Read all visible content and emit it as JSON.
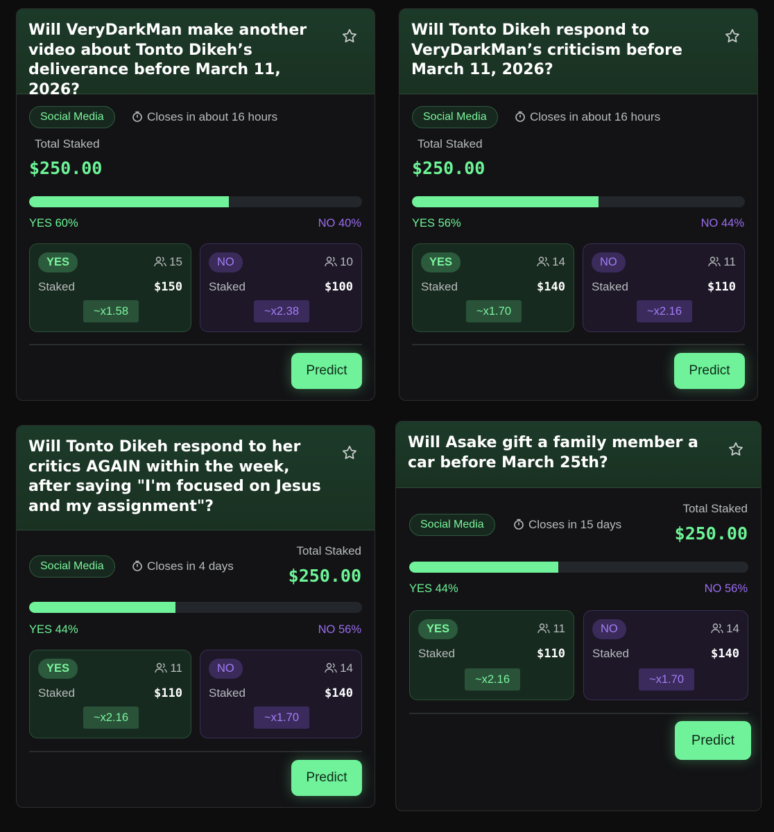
{
  "colors": {
    "accent_yes": "#6ff29a",
    "accent_no": "#9a6cf0",
    "background": "#0d0d0e"
  },
  "icons": {
    "favorite": "star-icon",
    "closes": "stopwatch-icon",
    "participants": "users-icon"
  },
  "cards": [
    {
      "title": "Will VeryDarkMan make another video about Tonto Dikeh’s deliverance before March 11, 2026?",
      "category": "Social Media",
      "closes": "Closes in about 16 hours",
      "total_staked_label": "Total Staked",
      "total_staked": "$250.00",
      "yes_share": 0.6,
      "yes_pct_label": "YES 60%",
      "no_pct_label": "NO 40%",
      "yes": {
        "label": "YES",
        "count": "15",
        "staked_label": "Staked",
        "staked": "$150",
        "multiplier": "~x1.58"
      },
      "no": {
        "label": "NO",
        "count": "10",
        "staked_label": "Staked",
        "staked": "$100",
        "multiplier": "~x2.38"
      },
      "predict_label": "Predict"
    },
    {
      "title": "Will Tonto Dikeh respond to VeryDarkMan’s criticism before March 11, 2026?",
      "category": "Social Media",
      "closes": "Closes in about 16 hours",
      "total_staked_label": "Total Staked",
      "total_staked": "$250.00",
      "yes_share": 0.56,
      "yes_pct_label": "YES 56%",
      "no_pct_label": "NO 44%",
      "yes": {
        "label": "YES",
        "count": "14",
        "staked_label": "Staked",
        "staked": "$140",
        "multiplier": "~x1.70"
      },
      "no": {
        "label": "NO",
        "count": "11",
        "staked_label": "Staked",
        "staked": "$110",
        "multiplier": "~x2.16"
      },
      "predict_label": "Predict"
    },
    {
      "title": "Will Tonto Dikeh respond to her critics AGAIN within the week, after saying \"I'm focused on Jesus and my assignment\"?",
      "category": "Social Media",
      "closes": "Closes in 4 days",
      "total_staked_label": "Total Staked",
      "total_staked": "$250.00",
      "yes_share": 0.44,
      "yes_pct_label": "YES 44%",
      "no_pct_label": "NO 56%",
      "yes": {
        "label": "YES",
        "count": "11",
        "staked_label": "Staked",
        "staked": "$110",
        "multiplier": "~x2.16"
      },
      "no": {
        "label": "NO",
        "count": "14",
        "staked_label": "Staked",
        "staked": "$140",
        "multiplier": "~x1.70"
      },
      "predict_label": "Predict"
    },
    {
      "title": "Will Asake gift a family member a car before March 25th?",
      "category": "Social Media",
      "closes": "Closes in 15 days",
      "total_staked_label": "Total Staked",
      "total_staked": "$250.00",
      "yes_share": 0.44,
      "yes_pct_label": "YES 44%",
      "no_pct_label": "NO 56%",
      "yes": {
        "label": "YES",
        "count": "11",
        "staked_label": "Staked",
        "staked": "$110",
        "multiplier": "~x2.16"
      },
      "no": {
        "label": "NO",
        "count": "14",
        "staked_label": "Staked",
        "staked": "$140",
        "multiplier": "~x1.70"
      },
      "predict_label": "Predict"
    }
  ]
}
